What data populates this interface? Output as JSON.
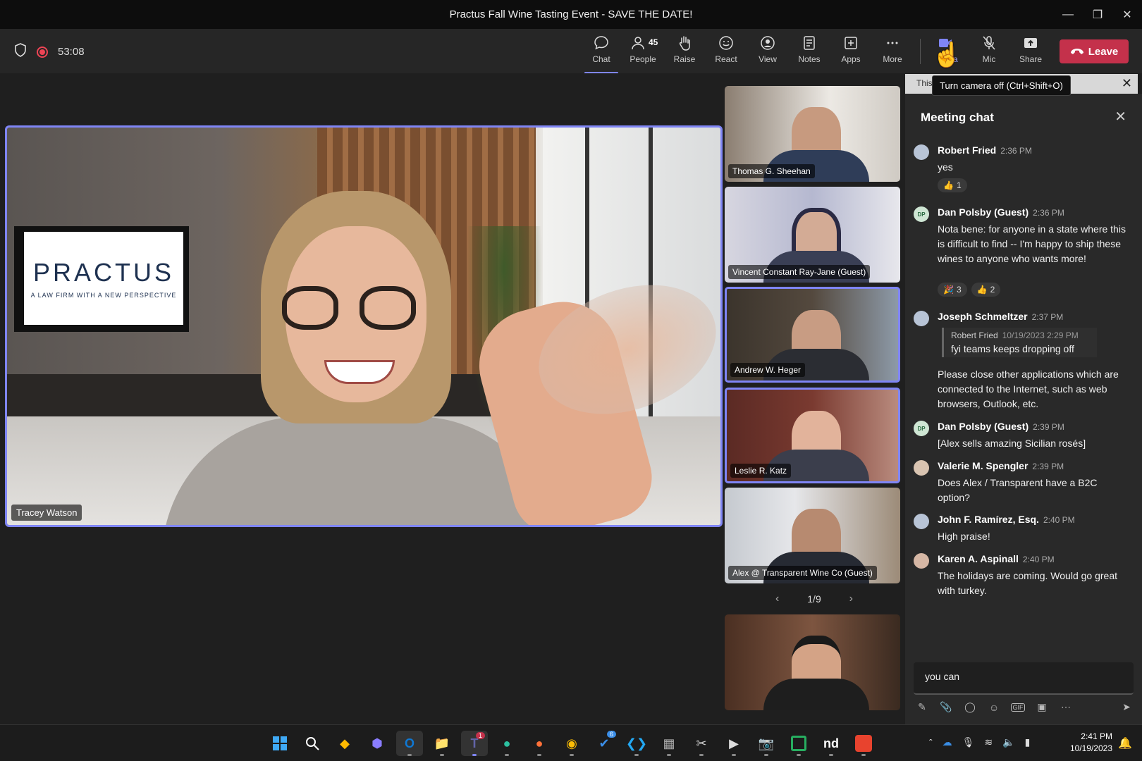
{
  "window": {
    "title": "Practus Fall Wine Tasting Event - SAVE THE DATE!",
    "controls": [
      "minimize",
      "restore",
      "close"
    ]
  },
  "toolbar": {
    "timer": "53:08",
    "buttons": [
      {
        "icon": "chat-icon",
        "label": "Chat",
        "active": true
      },
      {
        "icon": "people-icon",
        "label": "People",
        "count": "45"
      },
      {
        "icon": "raise-hand-icon",
        "label": "Raise"
      },
      {
        "icon": "react-icon",
        "label": "React"
      },
      {
        "icon": "view-icon",
        "label": "View"
      },
      {
        "icon": "notes-icon",
        "label": "Notes"
      },
      {
        "icon": "apps-icon",
        "label": "Apps"
      },
      {
        "icon": "more-icon",
        "label": "More"
      },
      {
        "icon": "camera-icon",
        "label": "era"
      },
      {
        "icon": "mic-off-icon",
        "label": "Mic"
      },
      {
        "icon": "share-icon",
        "label": "Share"
      }
    ],
    "leave_label": "Leave",
    "tooltip": "Turn camera off (Ctrl+Shift+O)"
  },
  "banner": {
    "text": "This"
  },
  "main_video": {
    "name": "Tracey Watson",
    "logo_text": "PRACTUS",
    "logo_tagline": "A LAW FIRM WITH A NEW PERSPECTIVE"
  },
  "thumbnails": [
    {
      "name": "Thomas G. Sheehan",
      "speaking": false
    },
    {
      "name": "Vincent Constant Ray-Jane (Guest)",
      "speaking": false
    },
    {
      "name": "Andrew W. Heger",
      "speaking": true
    },
    {
      "name": "Leslie R. Katz",
      "speaking": true
    },
    {
      "name": "Alex @ Transparent Wine Co (Guest)",
      "speaking": false
    },
    {
      "name": "",
      "speaking": false
    }
  ],
  "pager": {
    "text": "1/9"
  },
  "chat": {
    "title": "Meeting chat",
    "messages": [
      {
        "author": "Robert Fried",
        "time": "2:36 PM",
        "text": "yes",
        "reactions": [
          {
            "emoji": "👍",
            "count": "1"
          }
        ]
      },
      {
        "author": "Dan Polsby (Guest)",
        "initials": "DP",
        "time": "2:36 PM",
        "text": "Nota bene: for anyone in a state where this is difficult to find -- I'm happy to ship these wines to anyone who wants more!",
        "reactions": [
          {
            "emoji": "🎉",
            "count": "3"
          },
          {
            "emoji": "👍",
            "count": "2"
          }
        ]
      },
      {
        "author": "Joseph Schmeltzer",
        "time": "2:37 PM",
        "quote": {
          "author": "Robert Fried",
          "time": "10/19/2023 2:29 PM",
          "text": "fyi teams keeps dropping off"
        },
        "text": "Please close other applications which are connected to the Internet, such as web browsers, Outlook, etc."
      },
      {
        "author": "Dan Polsby (Guest)",
        "initials": "DP",
        "time": "2:39 PM",
        "text": "[Alex sells amazing Sicilian rosés]"
      },
      {
        "author": "Valerie M. Spengler",
        "time": "2:39 PM",
        "text": "Does Alex / Transparent have a B2C option?"
      },
      {
        "author": "John F. Ramírez, Esq.",
        "time": "2:40 PM",
        "text": "High praise!"
      },
      {
        "author": "Karen A. Aspinall",
        "time": "2:40 PM",
        "text": "The holidays are coming.  Would go great with turkey."
      }
    ],
    "compose_value": "you can"
  },
  "taskbar": {
    "apps": [
      "windows-start-icon",
      "search-icon",
      "m365-icon",
      "copilot-icon",
      "outlook-icon",
      "file-explorer-icon",
      "teams-icon",
      "edge-icon",
      "firefox-icon",
      "chrome-icon",
      "todo-icon",
      "vscode-icon",
      "app-icon",
      "snip-icon",
      "media-player-icon",
      "camera-app-icon",
      "app-green-icon",
      "nd-icon",
      "app-red-icon"
    ],
    "nd_label": "nd",
    "teams_badge": "1",
    "todo_badge": "6",
    "time": "2:41 PM",
    "date": "10/19/2023"
  }
}
